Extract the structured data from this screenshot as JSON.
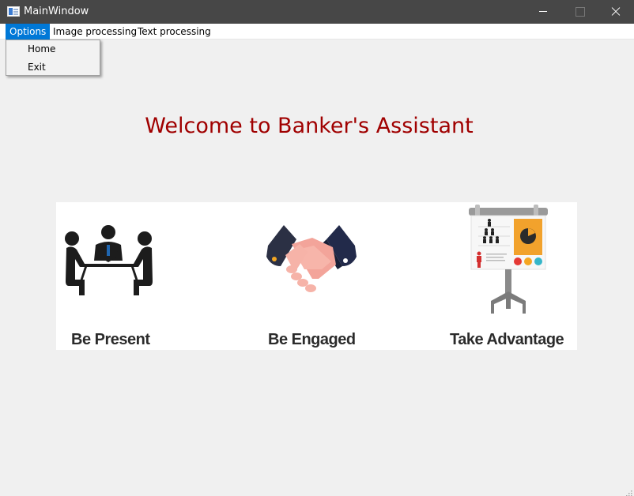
{
  "window": {
    "title": "MainWindow"
  },
  "menubar": {
    "options": "Options",
    "image_processing": "Image processing",
    "text_processing": "Text processing"
  },
  "options_menu": {
    "home": "Home",
    "exit": "Exit"
  },
  "main": {
    "welcome": "Welcome to Banker's Assistant",
    "features": [
      {
        "label": "Be Present",
        "icon": "meeting-icon"
      },
      {
        "label": "Be Engaged",
        "icon": "handshake-icon"
      },
      {
        "label": "Take Advantage",
        "icon": "presentation-board-icon"
      }
    ]
  },
  "colors": {
    "accent": "#0078d7",
    "welcome_text": "#a00000",
    "titlebar": "#474747"
  }
}
